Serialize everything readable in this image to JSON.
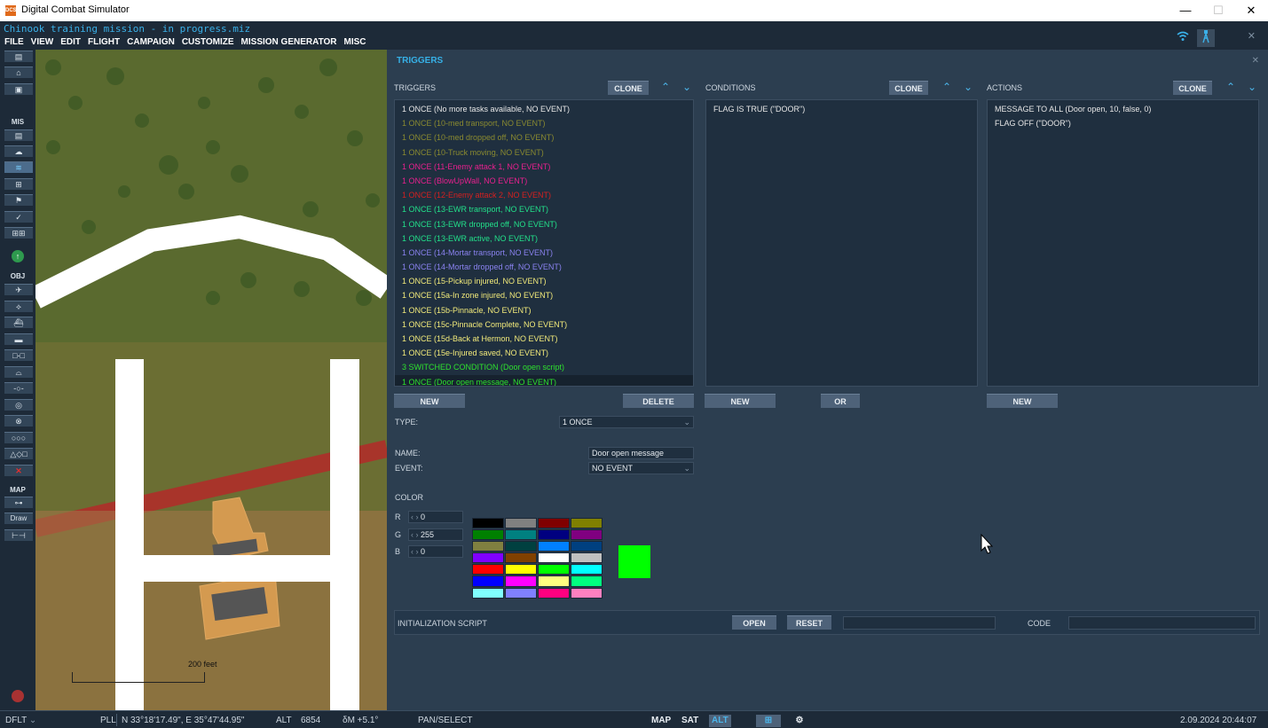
{
  "window": {
    "app_title": "Digital Combat Simulator",
    "app_icon_text": "DCS",
    "minimize": "—",
    "maximize": "☐",
    "close": "✕"
  },
  "mission_title": "Chinook training mission - in progress.miz",
  "menu": [
    "FILE",
    "VIEW",
    "EDIT",
    "FLIGHT",
    "CAMPAIGN",
    "CUSTOMIZE",
    "MISSION GENERATOR",
    "MISC"
  ],
  "top_icons": {
    "wifi": "wifi-icon",
    "tower": "radio-tower-icon",
    "close": "✕"
  },
  "toolbar": {
    "mis_label": "MIS",
    "obj_label": "OBJ",
    "map_label": "MAP",
    "draw_label": "Draw"
  },
  "map": {
    "scale_label": "200 feet"
  },
  "panel": {
    "title": "TRIGGERS",
    "close": "✕",
    "triggers_header": "TRIGGERS",
    "conditions_header": "CONDITIONS",
    "actions_header": "ACTIONS",
    "clone_label": "CLONE",
    "up_arrow": "⌃",
    "down_arrow": "⌄",
    "triggers": [
      {
        "text": "1 ONCE (No more tasks available, NO EVENT)",
        "color": "#e6e6e6"
      },
      {
        "text": "1 ONCE (10-med transport, NO EVENT)",
        "color": "#8a8a30"
      },
      {
        "text": "1 ONCE (10-med dropped off, NO EVENT)",
        "color": "#8a8a30"
      },
      {
        "text": "1 ONCE (10-Truck moving, NO EVENT)",
        "color": "#8a8a30"
      },
      {
        "text": "1 ONCE (11-Enemy attack 1, NO EVENT)",
        "color": "#e8208e"
      },
      {
        "text": "1 ONCE (BlowUpWall, NO EVENT)",
        "color": "#e8208e"
      },
      {
        "text": "1 ONCE (12-Enemy attack 2, NO EVENT)",
        "color": "#d42020"
      },
      {
        "text": "1 ONCE (13-EWR transport, NO EVENT)",
        "color": "#22e08a"
      },
      {
        "text": "1 ONCE (13-EWR dropped off, NO EVENT)",
        "color": "#22e08a"
      },
      {
        "text": "1 ONCE (13-EWR active, NO EVENT)",
        "color": "#22e08a"
      },
      {
        "text": "1 ONCE (14-Mortar transport, NO EVENT)",
        "color": "#8a82f0"
      },
      {
        "text": "1 ONCE (14-Mortar dropped off, NO EVENT)",
        "color": "#8a82f0"
      },
      {
        "text": "1 ONCE (15-Pickup injured, NO EVENT)",
        "color": "#f2ea7a"
      },
      {
        "text": "1 ONCE (15a-In zone injured, NO EVENT)",
        "color": "#f2ea7a"
      },
      {
        "text": "1 ONCE (15b-Pinnacle, NO EVENT)",
        "color": "#f2ea7a"
      },
      {
        "text": "1 ONCE (15c-Pinnacle Complete, NO EVENT)",
        "color": "#f2ea7a"
      },
      {
        "text": "1 ONCE (15d-Back at Hermon, NO EVENT)",
        "color": "#f2ea7a"
      },
      {
        "text": "1 ONCE (15e-Injured saved, NO EVENT)",
        "color": "#f2ea7a"
      },
      {
        "text": "3 SWITCHED CONDITION (Door open script)",
        "color": "#2ee02e"
      },
      {
        "text": "1 ONCE (Door open message, NO EVENT)",
        "color": "#2ee02e"
      }
    ],
    "selected_trigger_index": 19,
    "conditions": [
      "FLAG IS TRUE (\"DOOR\")"
    ],
    "actions": [
      "MESSAGE TO ALL (Door open, 10, false, 0)",
      "FLAG OFF (\"DOOR\")"
    ],
    "new_label": "NEW",
    "delete_label": "DELETE",
    "or_label": "OR",
    "type_label": "TYPE:",
    "type_value": "1 ONCE",
    "name_label": "NAME:",
    "name_value": "Door open message",
    "event_label": "EVENT:",
    "event_value": "NO EVENT",
    "color_label": "COLOR",
    "r_label": "R",
    "r_value": "0",
    "g_label": "G",
    "g_value": "255",
    "b_label": "B",
    "b_value": "0",
    "spin_arrows": "‹ ›",
    "selected_color": "#00ff00",
    "palette": [
      "#000000",
      "#808080",
      "#800000",
      "#808000",
      "#008000",
      "#008080",
      "#000080",
      "#800080",
      "#808040",
      "#004040",
      "#0080ff",
      "#004080",
      "#8000ff",
      "#804000",
      "#ffffff",
      "#c0c0c0",
      "#ff0000",
      "#ffff00",
      "#00ff00",
      "#00ffff",
      "#0000ff",
      "#ff00ff",
      "#ffff80",
      "#00ff80",
      "#80ffff",
      "#8080ff",
      "#ff0080",
      "#ff80c0"
    ],
    "init_script_label": "INITIALIZATION SCRIPT",
    "open_label": "OPEN",
    "reset_label": "RESET",
    "code_label": "CODE"
  },
  "status": {
    "profile": "DFLT",
    "profile_caret": "⌄",
    "coord_type": "PLL",
    "coords": "N 33°18'17.49\", E 35°47'44.95\"",
    "alt_label": "ALT",
    "alt_value": "6854",
    "delta_m": "δM +5.1°",
    "mode": "PAN/SELECT",
    "map_btn": "MAP",
    "sat_btn": "SAT",
    "alt_btn": "ALT",
    "datetime": "2.09.2024 20:44:07"
  }
}
